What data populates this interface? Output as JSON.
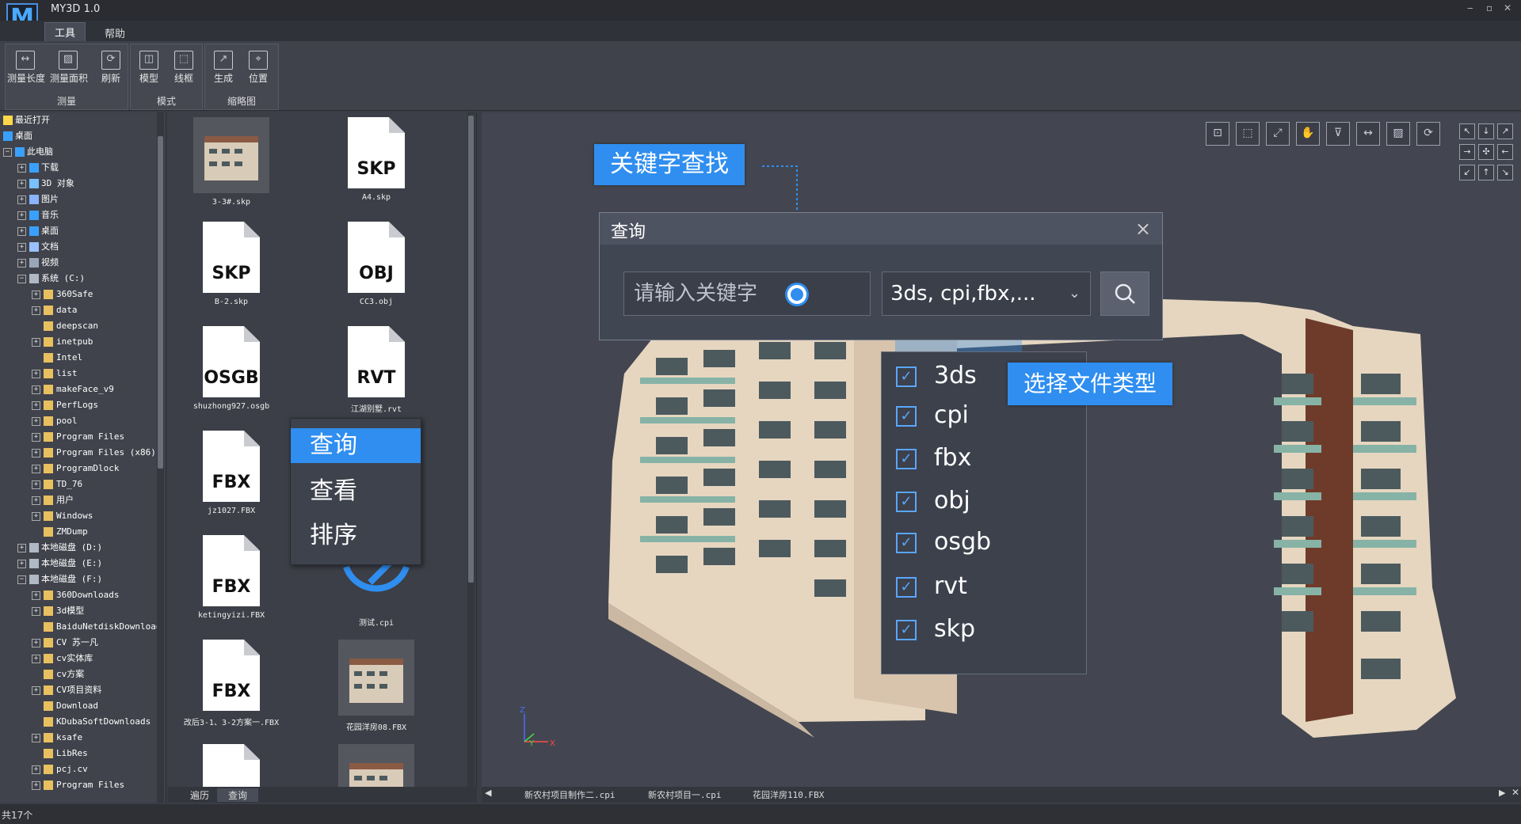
{
  "app": {
    "title": "MY3D 1.0",
    "logo": "M"
  },
  "menu": {
    "items": [
      "工具",
      "帮助"
    ]
  },
  "ribbon": {
    "groups": [
      {
        "label": "测量",
        "buttons": [
          "测量长度",
          "测量面积",
          "刷新"
        ]
      },
      {
        "label": "模式",
        "buttons": [
          "模型",
          "线框"
        ]
      },
      {
        "label": "缩略图",
        "buttons": [
          "生成",
          "位置"
        ]
      }
    ]
  },
  "tree": {
    "rows": [
      {
        "label": "最近打开",
        "exp": "",
        "icon": "star-icon"
      },
      {
        "label": "桌面",
        "exp": "",
        "icon": "desktop-icon"
      },
      {
        "label": "此电脑",
        "exp": "−",
        "icon": "computer-icon"
      },
      {
        "label": "下载",
        "exp": "+",
        "icon": "download-icon"
      },
      {
        "label": "3D 对象",
        "exp": "+",
        "icon": "cube-icon"
      },
      {
        "label": "图片",
        "exp": "+",
        "icon": "picture-icon"
      },
      {
        "label": "音乐",
        "exp": "+",
        "icon": "music-icon"
      },
      {
        "label": "桌面",
        "exp": "+",
        "icon": "desktop-icon"
      },
      {
        "label": "文档",
        "exp": "+",
        "icon": "document-icon"
      },
      {
        "label": "视频",
        "exp": "+",
        "icon": "video-icon"
      },
      {
        "label": "系统 (C:)",
        "exp": "−",
        "icon": "drive-icon"
      },
      {
        "label": "360Safe",
        "exp": "+",
        "icon": "folder-icon"
      },
      {
        "label": "data",
        "exp": "+",
        "icon": "folder-icon"
      },
      {
        "label": "deepscan",
        "exp": "",
        "icon": "folder-icon"
      },
      {
        "label": "inetpub",
        "exp": "+",
        "icon": "folder-icon"
      },
      {
        "label": "Intel",
        "exp": "",
        "icon": "folder-icon"
      },
      {
        "label": "list",
        "exp": "+",
        "icon": "folder-icon"
      },
      {
        "label": "makeFace_v9",
        "exp": "+",
        "icon": "folder-icon"
      },
      {
        "label": "PerfLogs",
        "exp": "+",
        "icon": "folder-icon"
      },
      {
        "label": "pool",
        "exp": "+",
        "icon": "folder-icon"
      },
      {
        "label": "Program Files",
        "exp": "+",
        "icon": "folder-icon"
      },
      {
        "label": "Program Files (x86)",
        "exp": "+",
        "icon": "folder-icon"
      },
      {
        "label": "ProgramDlock",
        "exp": "+",
        "icon": "folder-icon"
      },
      {
        "label": "TD_76",
        "exp": "+",
        "icon": "folder-icon"
      },
      {
        "label": "用户",
        "exp": "+",
        "icon": "folder-icon"
      },
      {
        "label": "Windows",
        "exp": "+",
        "icon": "folder-icon"
      },
      {
        "label": "ZMDump",
        "exp": "",
        "icon": "folder-icon"
      },
      {
        "label": "本地磁盘 (D:)",
        "exp": "+",
        "icon": "drive-icon"
      },
      {
        "label": "本地磁盘 (E:)",
        "exp": "+",
        "icon": "drive-icon"
      },
      {
        "label": "本地磁盘 (F:)",
        "exp": "−",
        "icon": "drive-icon"
      },
      {
        "label": "360Downloads",
        "exp": "+",
        "icon": "folder-icon"
      },
      {
        "label": "3d模型",
        "exp": "+",
        "icon": "folder-icon"
      },
      {
        "label": "BaiduNetdiskDownload",
        "exp": "",
        "icon": "folder-icon"
      },
      {
        "label": "CV 苏一凡",
        "exp": "+",
        "icon": "folder-icon"
      },
      {
        "label": "cv实体库",
        "exp": "+",
        "icon": "folder-icon"
      },
      {
        "label": "cv方案",
        "exp": "",
        "icon": "folder-icon"
      },
      {
        "label": "CV项目资料",
        "exp": "+",
        "icon": "folder-icon"
      },
      {
        "label": "Download",
        "exp": "",
        "icon": "folder-icon"
      },
      {
        "label": "KDubaSoftDownloads",
        "exp": "",
        "icon": "folder-icon"
      },
      {
        "label": "ksafe",
        "exp": "+",
        "icon": "folder-icon"
      },
      {
        "label": "LibRes",
        "exp": "",
        "icon": "folder-icon"
      },
      {
        "label": "pcj.cv",
        "exp": "+",
        "icon": "folder-icon"
      },
      {
        "label": "Program Files",
        "exp": "+",
        "icon": "folder-icon"
      }
    ]
  },
  "files": [
    {
      "name": "3-3#.skp",
      "ext": "",
      "kind": "thumb"
    },
    {
      "name": "A4.skp",
      "ext": "SKP",
      "kind": "doc"
    },
    {
      "name": "B-2.skp",
      "ext": "SKP",
      "kind": "doc"
    },
    {
      "name": "CC3.obj",
      "ext": "OBJ",
      "kind": "doc"
    },
    {
      "name": "shuzhong927.osgb",
      "ext": "OSGB",
      "kind": "doc"
    },
    {
      "name": "江湖别墅.rvt",
      "ext": "RVT",
      "kind": "doc"
    },
    {
      "name": "jz1027.FBX",
      "ext": "FBX",
      "kind": "doc"
    },
    {
      "name": "",
      "ext": "",
      "kind": "hidden"
    },
    {
      "name": "ketingyizi.FBX",
      "ext": "FBX",
      "kind": "doc"
    },
    {
      "name": "测试.cpi",
      "ext": "",
      "kind": "cpi"
    },
    {
      "name": "改后3-1、3-2方案一.FBX",
      "ext": "FBX",
      "kind": "doc"
    },
    {
      "name": "花园洋房08.FBX",
      "ext": "",
      "kind": "thumb"
    },
    {
      "name": "",
      "ext": "FBX",
      "kind": "doc"
    },
    {
      "name": "",
      "ext": "",
      "kind": "thumb"
    }
  ],
  "bottom_tabs": [
    "遍历",
    "查询"
  ],
  "context_menu": {
    "items": [
      "查询",
      "查看",
      "排序"
    ],
    "selected": 0
  },
  "callouts": {
    "keyword": "关键字查找",
    "filetype": "选择文件类型"
  },
  "dialog": {
    "title": "查询",
    "close": "×",
    "placeholder": "请输入关键字",
    "filetype_value": "3ds, cpi,fbx,...",
    "dropdown_icon": "chevron-down-icon",
    "search_icon": "search-icon"
  },
  "file_types": [
    "3ds",
    "cpi",
    "fbx",
    "obj",
    "osgb",
    "rvt",
    "skp"
  ],
  "view_tabs": [
    "新农村项目制作二.cpi",
    "新农村项目一.cpi",
    "花园洋房110.FBX"
  ],
  "status": {
    "text": "共17个"
  },
  "axis": {
    "z": "Z",
    "y": "Y",
    "x": "X"
  },
  "colors": {
    "accent": "#2f8eef",
    "background": "#3a3d45"
  }
}
